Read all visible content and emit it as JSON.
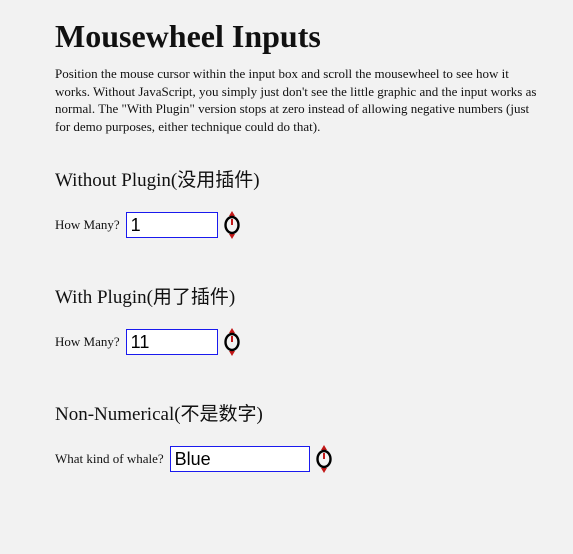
{
  "title": "Mousewheel Inputs",
  "description": "Position the mouse cursor within the input box and scroll the mousewheel to see how it works. Without JavaScript, you simply just don't see the little graphic and the input works as normal. The \"With Plugin\" version stops at zero instead of allowing negative numbers (just for demo purposes, either technique could do that).",
  "sections": [
    {
      "heading": "Without Plugin(没用插件)",
      "label": "How Many?",
      "value": "1"
    },
    {
      "heading": "With Plugin(用了插件)",
      "label": "How Many?",
      "value": "11"
    },
    {
      "heading": "Non-Numerical(不是数字)",
      "label": "What kind of whale?",
      "value": "Blue"
    }
  ]
}
